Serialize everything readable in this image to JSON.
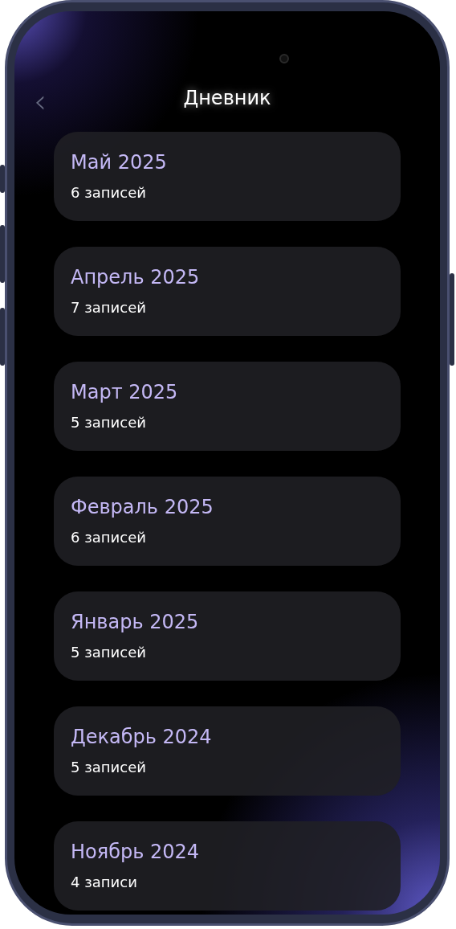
{
  "header": {
    "back": "‹",
    "title": "Дневник"
  },
  "months": [
    {
      "title": "Май 2025",
      "count": "6 записей"
    },
    {
      "title": "Апрель 2025",
      "count": "7 записей"
    },
    {
      "title": "Март 2025",
      "count": "5 записей"
    },
    {
      "title": "Февраль 2025",
      "count": "6 записей"
    },
    {
      "title": "Январь 2025",
      "count": "5 записей"
    },
    {
      "title": "Декабрь 2024",
      "count": "5 записей"
    },
    {
      "title": "Ноябрь 2024",
      "count": "4 записи"
    }
  ]
}
